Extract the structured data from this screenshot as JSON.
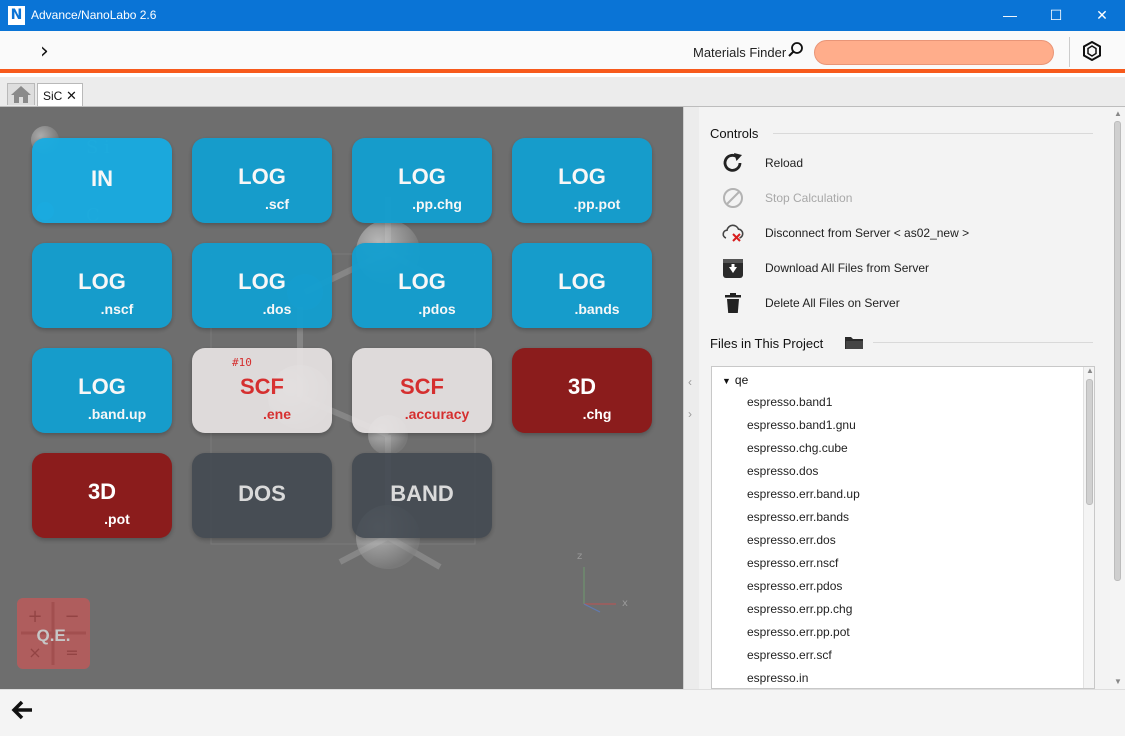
{
  "window": {
    "title": "Advance/NanoLabo 2.6",
    "logo_letter": "N",
    "minimize": "—",
    "maximize": "☐",
    "close": "✕"
  },
  "toolbar": {
    "expand_icon": "›",
    "finder_label": "Materials Finder",
    "search_value": "",
    "accent_color": "#f75a1c"
  },
  "tabs": [
    {
      "label": "SiC",
      "close": "✕"
    }
  ],
  "tiles": [
    {
      "main": "IN",
      "sub": "",
      "style": "light-blue"
    },
    {
      "main": "LOG",
      "sub": ".scf",
      "style": "blue"
    },
    {
      "main": "LOG",
      "sub": ".pp.chg",
      "style": "blue"
    },
    {
      "main": "LOG",
      "sub": ".pp.pot",
      "style": "blue"
    },
    {
      "main": "LOG",
      "sub": ".nscf",
      "style": "blue"
    },
    {
      "main": "LOG",
      "sub": ".dos",
      "style": "blue"
    },
    {
      "main": "LOG",
      "sub": ".pdos",
      "style": "blue"
    },
    {
      "main": "LOG",
      "sub": ".bands",
      "style": "blue"
    },
    {
      "main": "LOG",
      "sub": ".band.up",
      "style": "blue"
    },
    {
      "main": "SCF",
      "sub": ".ene",
      "style": "white",
      "badge": "#10"
    },
    {
      "main": "SCF",
      "sub": ".accuracy",
      "style": "white"
    },
    {
      "main": "3D",
      "sub": ".chg",
      "style": "red"
    },
    {
      "main": "3D",
      "sub": ".pot",
      "style": "red"
    },
    {
      "main": "DOS",
      "sub": "",
      "style": "dark"
    },
    {
      "main": "BAND",
      "sub": "",
      "style": "dark"
    }
  ],
  "qe_button": {
    "label": "Q.E."
  },
  "controls": {
    "title": "Controls",
    "items": [
      {
        "label": "Reload",
        "icon": "reload-icon",
        "enabled": true
      },
      {
        "label": "Stop Calculation",
        "icon": "stop-icon",
        "enabled": false
      },
      {
        "label": "Disconnect from Server < as02_new >",
        "icon": "cloud-disconnect-icon",
        "enabled": true
      },
      {
        "label": "Download All Files from Server",
        "icon": "download-icon",
        "enabled": true
      },
      {
        "label": "Delete All Files on Server",
        "icon": "trash-icon",
        "enabled": true
      }
    ]
  },
  "files": {
    "title": "Files in This Project",
    "root": "qe",
    "items": [
      "espresso.band1",
      "espresso.band1.gnu",
      "espresso.chg.cube",
      "espresso.dos",
      "espresso.err.band.up",
      "espresso.err.bands",
      "espresso.err.dos",
      "espresso.err.nscf",
      "espresso.err.pdos",
      "espresso.err.pp.chg",
      "espresso.err.pp.pot",
      "espresso.err.scf",
      "espresso.in"
    ]
  },
  "bottombar": {
    "back_icon": "🡐"
  }
}
